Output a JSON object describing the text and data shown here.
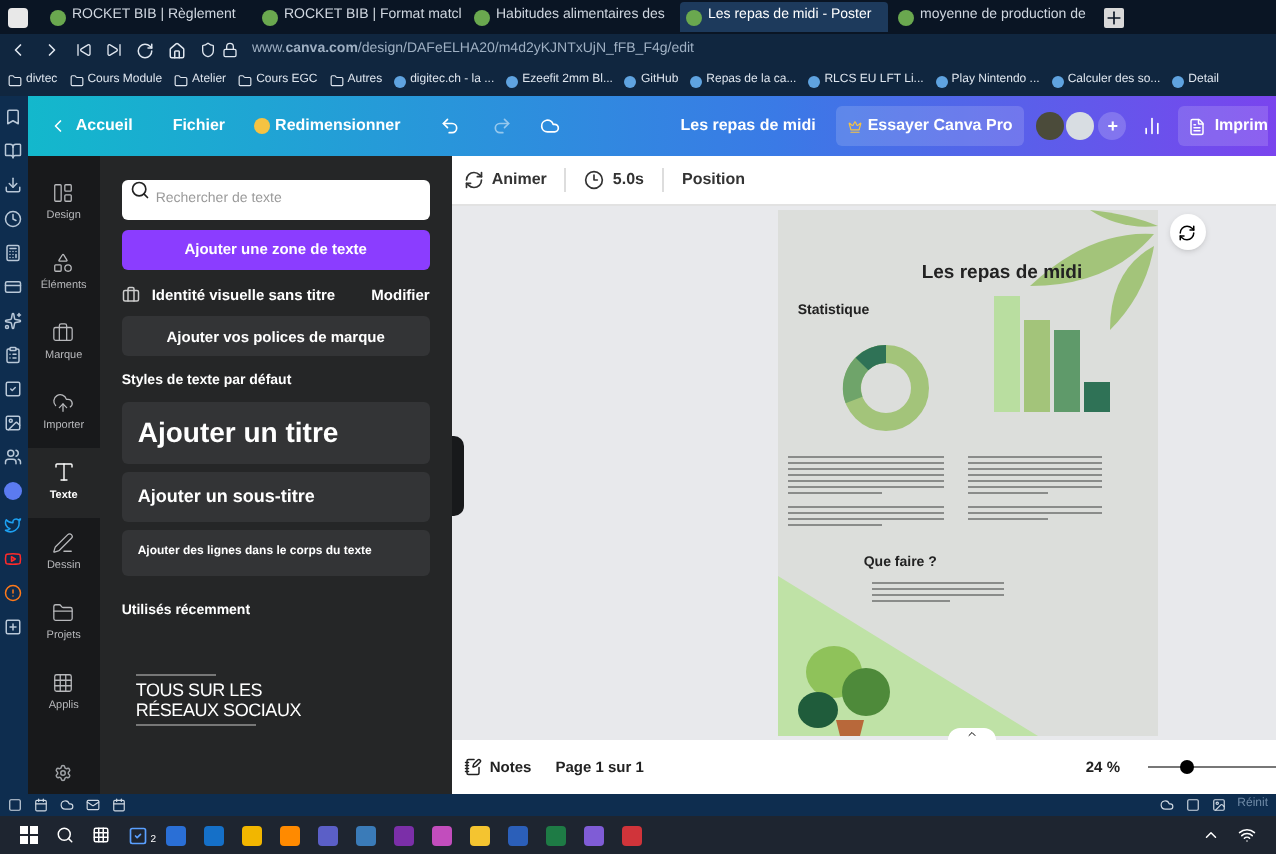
{
  "browser": {
    "tabs": [
      {
        "label": "ROCKET BIB | Règlement",
        "selected": false
      },
      {
        "label": "ROCKET BIB | Format matcl",
        "selected": false
      },
      {
        "label": "Habitudes alimentaires des",
        "selected": false
      },
      {
        "label": "Les repas de midi - Poster",
        "selected": true
      },
      {
        "label": "moyenne de production de",
        "selected": false
      }
    ],
    "url": "www.**canva.com**/design/DAFeELHA20/m4d2yKJNTxUjN_fFB_F4g/edit",
    "bookmarks": [
      {
        "label": "divtec",
        "kind": "folder"
      },
      {
        "label": "Cours Module",
        "kind": "folder"
      },
      {
        "label": "Atelier",
        "kind": "folder"
      },
      {
        "label": "Cours EGC",
        "kind": "folder"
      },
      {
        "label": "Autres",
        "kind": "folder"
      },
      {
        "label": "digitec.ch - la ...",
        "kind": "site"
      },
      {
        "label": "Ezeefit 2mm Bl...",
        "kind": "site"
      },
      {
        "label": "GitHub",
        "kind": "site"
      },
      {
        "label": "Repas de la ca...",
        "kind": "site"
      },
      {
        "label": "RLCS EU LFT Li...",
        "kind": "site"
      },
      {
        "label": "Play Nintendo ...",
        "kind": "site"
      },
      {
        "label": "Calculer des so...",
        "kind": "site"
      },
      {
        "label": "Detail",
        "kind": "site"
      }
    ]
  },
  "header": {
    "back": "Accueil",
    "file": "Fichier",
    "resize": "Redimensionner",
    "title": "Les repas de midi",
    "pro": "Essayer Canva Pro",
    "add": "+",
    "print": "Imprim"
  },
  "toolbar": {
    "animate": "Animer",
    "duration": "5.0s",
    "position": "Position"
  },
  "side_nav": [
    {
      "label": "Design",
      "selected": false
    },
    {
      "label": "Éléments",
      "selected": false
    },
    {
      "label": "Marque",
      "selected": false
    },
    {
      "label": "Importer",
      "selected": false
    },
    {
      "label": "Texte",
      "selected": true
    },
    {
      "label": "Dessin",
      "selected": false
    },
    {
      "label": "Projets",
      "selected": false
    },
    {
      "label": "Applis",
      "selected": false
    }
  ],
  "panel": {
    "search": {
      "placeholder": "Rechercher de texte"
    },
    "add_text": "Ajouter une zone de texte",
    "brand": {
      "name": "Identité visuelle sans titre",
      "action": "Modifier"
    },
    "brand_fonts": "Ajouter vos polices de marque",
    "styles_heading": "Styles de texte par défaut",
    "styles": [
      {
        "kind": "title",
        "label": "Ajouter un titre"
      },
      {
        "kind": "subtitle",
        "label": "Ajouter un sous-titre"
      },
      {
        "kind": "body",
        "label": "Ajouter des lignes dans le corps du texte"
      }
    ],
    "recent_heading": "Utilisés récemment",
    "recent": [
      "TOUS SUR LES",
      "RÉSEAUX SOCIAUX"
    ]
  },
  "poster": {
    "title": "Les repas de midi",
    "subtitle": "Statistique",
    "section": "Que faire ?"
  },
  "footer": {
    "notes": "Notes",
    "page": "Page 1 sur 1",
    "zoom": "24 %",
    "zoom_slider": {
      "level": 0.3
    }
  },
  "status_bar": {
    "text": "Réinit"
  },
  "taskbar": {
    "badge": "2"
  }
}
